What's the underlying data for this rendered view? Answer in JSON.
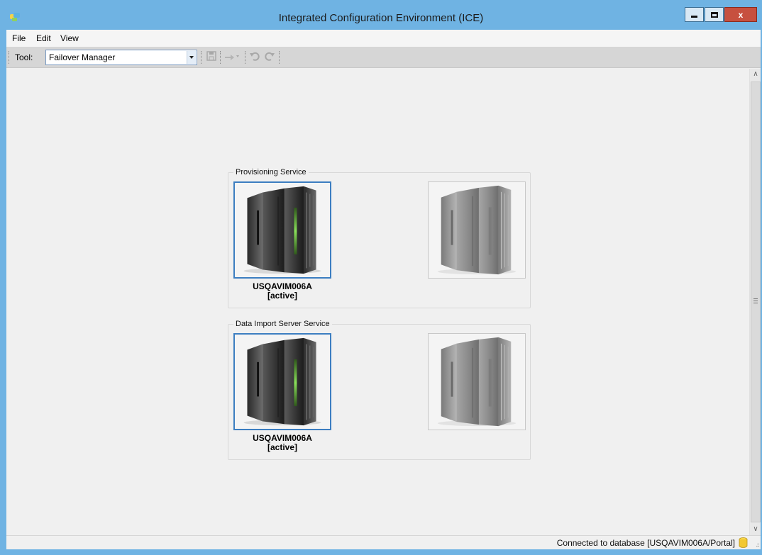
{
  "window": {
    "title": "Integrated Configuration Environment (ICE)",
    "close_label": "x"
  },
  "menu": {
    "items": [
      {
        "label": "File"
      },
      {
        "label": "Edit"
      },
      {
        "label": "View"
      }
    ]
  },
  "toolbar": {
    "tool_label": "Tool:",
    "tool_value": "Failover Manager"
  },
  "groups": [
    {
      "title": "Provisioning Service",
      "primary": {
        "name": "USQAVIM006A",
        "status": "[active]"
      }
    },
    {
      "title": "Data Import Server Service",
      "primary": {
        "name": "USQAVIM006A",
        "status": "[active]"
      }
    }
  ],
  "status": {
    "text": "Connected to database [USQAVIM006A/Portal]"
  },
  "colors": {
    "window_frame": "#6fb3e3",
    "close_button": "#c7503f",
    "selection": "#3c7ec1",
    "server_led": "#7ed84a"
  }
}
